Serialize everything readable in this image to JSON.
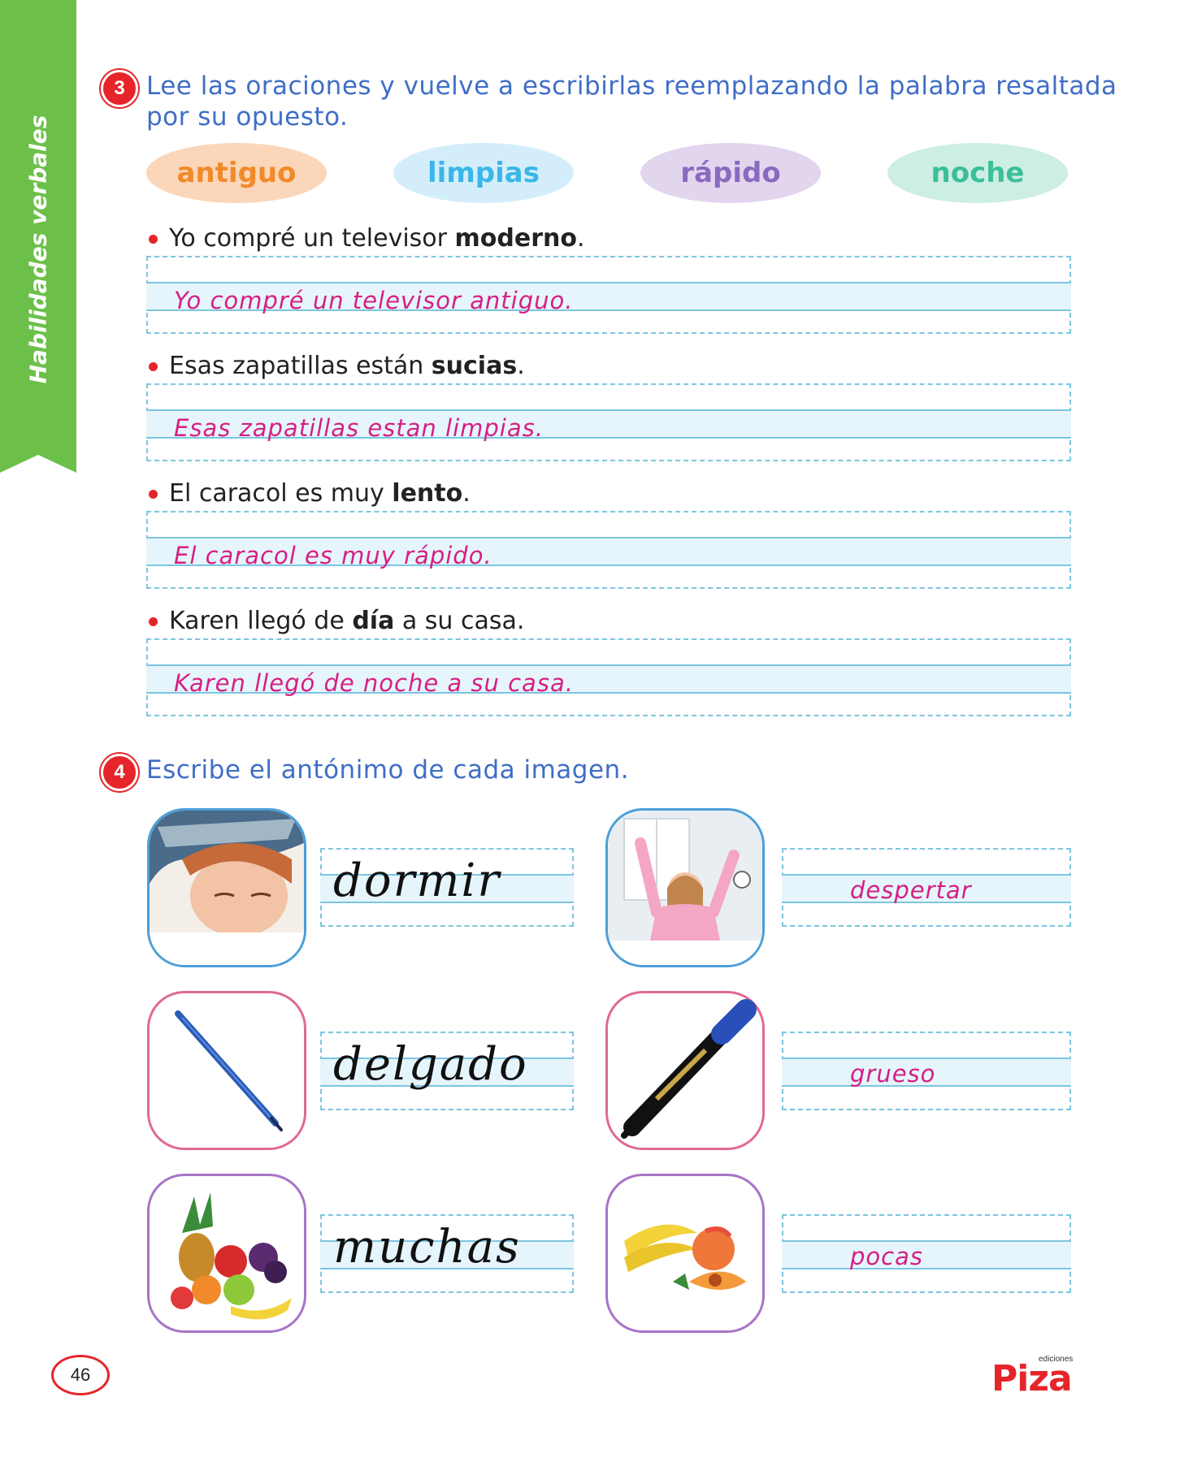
{
  "sidebar": {
    "label": "Habilidades verbales",
    "color": "#6cc04a"
  },
  "exercise3": {
    "number": "3",
    "instruction_line1": "Lee las oraciones y vuelve a escribirlas reemplazando la palabra resaltada",
    "instruction_line2": "por su opuesto.",
    "word_bank": [
      {
        "word": "antiguo",
        "bg": "#fbd6b8",
        "color": "#f08a2a"
      },
      {
        "word": "limpias",
        "bg": "#d3eefa",
        "color": "#3ab6e8"
      },
      {
        "word": "rápido",
        "bg": "#e2d5ee",
        "color": "#8a6ac0"
      },
      {
        "word": "noche",
        "bg": "#cdeee2",
        "color": "#3bbf9a"
      }
    ],
    "items": [
      {
        "pre": "Yo compré un televisor ",
        "bold": "moderno",
        "post": ".",
        "answer": "Yo compré un televisor antiguo."
      },
      {
        "pre": "Esas zapatillas están ",
        "bold": "sucias",
        "post": ".",
        "answer": "Esas zapatillas estan limpias."
      },
      {
        "pre": "El caracol es muy ",
        "bold": "lento",
        "post": ".",
        "answer": "El caracol es muy rápido."
      },
      {
        "pre": "Karen llegó de ",
        "bold": "día",
        "post": " a su casa.",
        "answer": "Karen llegó de noche a su casa."
      }
    ]
  },
  "exercise4": {
    "number": "4",
    "instruction": "Escribe el antónimo de cada imagen.",
    "pairs": [
      {
        "left_icon": "sleeping-girl-photo",
        "left_word": "dormir",
        "right_icon": "waking-girl-photo",
        "right_word": "despertar"
      },
      {
        "left_icon": "thin-pen-photo",
        "left_word": "delgado",
        "right_icon": "thick-marker-photo",
        "right_word": "grueso"
      },
      {
        "left_icon": "many-fruits-photo",
        "left_word": "muchas",
        "right_icon": "few-fruits-photo",
        "right_word": "pocas"
      }
    ]
  },
  "footer": {
    "page_number": "46",
    "logo_small": "ediciones",
    "logo": "Piza"
  }
}
